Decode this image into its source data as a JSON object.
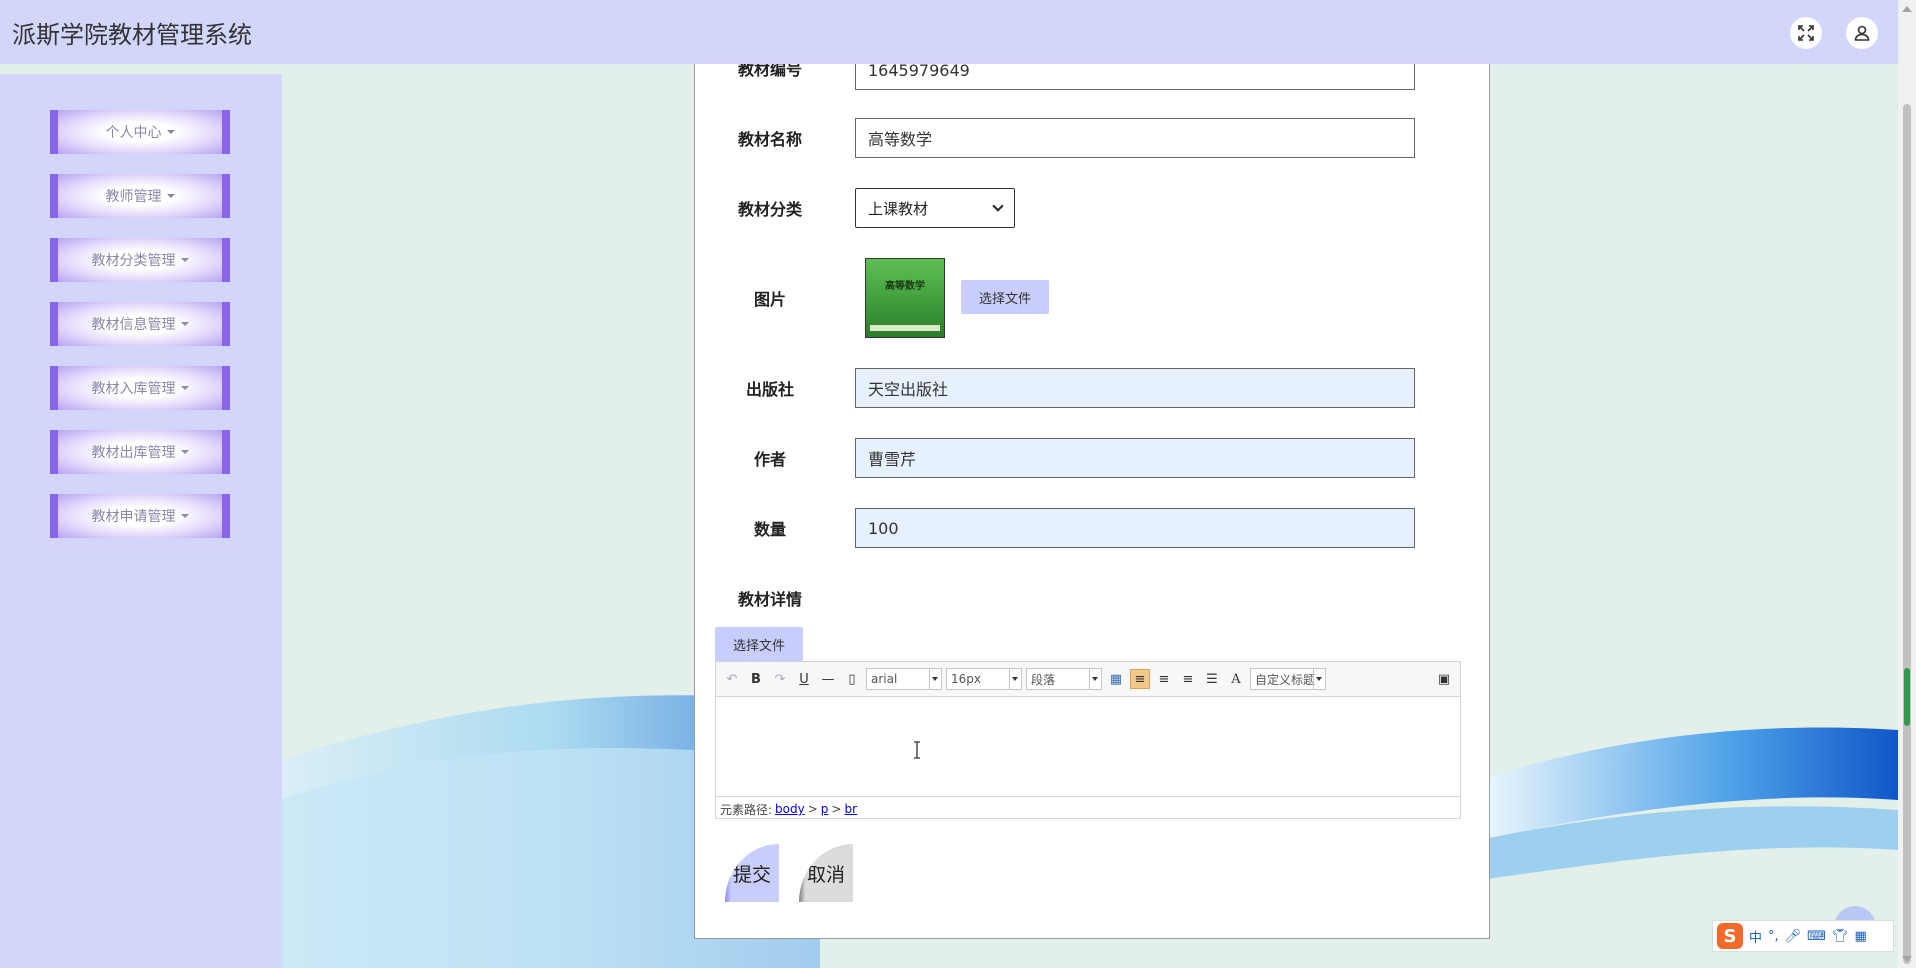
{
  "app": {
    "title": "派斯学院教材管理系统"
  },
  "header": {
    "fullscreen_icon": "fullscreen-icon",
    "user_icon": "user-icon"
  },
  "sidebar": {
    "items": [
      {
        "label": "个人中心"
      },
      {
        "label": "教师管理"
      },
      {
        "label": "教材分类管理"
      },
      {
        "label": "教材信息管理"
      },
      {
        "label": "教材入库管理"
      },
      {
        "label": "教材出库管理"
      },
      {
        "label": "教材申请管理"
      }
    ]
  },
  "form": {
    "code": {
      "label": "教材编号",
      "value": "1645979649"
    },
    "name": {
      "label": "教材名称",
      "value": "高等数学"
    },
    "category": {
      "label": "教材分类",
      "value": "上课教材"
    },
    "image": {
      "label": "图片",
      "thumb_title": "高等数学",
      "button": "选择文件"
    },
    "publisher": {
      "label": "出版社",
      "value": "天空出版社"
    },
    "author": {
      "label": "作者",
      "value": "曹雪芹"
    },
    "quantity": {
      "label": "数量",
      "value": "100"
    },
    "details": {
      "label": "教材详情",
      "file_button": "选择文件"
    }
  },
  "editor": {
    "toolbar": {
      "font_family": "arial",
      "font_size": "16px",
      "paragraph": "段落",
      "custom_title": "自定义标题",
      "bold": "B",
      "underline": "U",
      "font_color": "A"
    },
    "status": {
      "prefix": "元素路径:",
      "path": [
        "body",
        "p",
        "br"
      ],
      "separator": ">"
    }
  },
  "actions": {
    "submit": "提交",
    "cancel": "取消"
  },
  "ime": {
    "lang": "中",
    "punct": "°,"
  },
  "colors": {
    "header_bg": "#d3d6fb",
    "sidebar_bg": "#d3d6fb",
    "menu_accent": "#8a63e8",
    "input_blue": "#e7f0fd",
    "file_button": "#c9cdfb"
  }
}
